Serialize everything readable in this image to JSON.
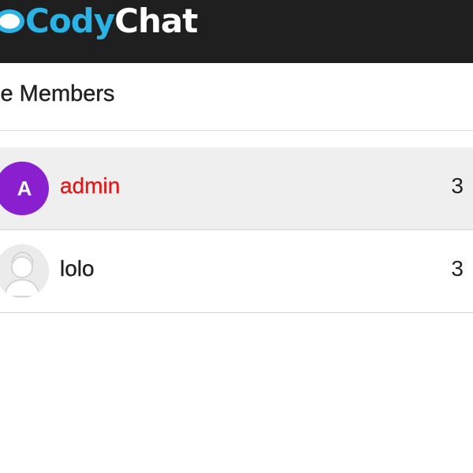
{
  "app": {
    "logo_part1": "Cody",
    "logo_part2": "Chat"
  },
  "panel": {
    "title": "ce Members"
  },
  "members": [
    {
      "name": "admin",
      "avatar_letter": "A",
      "count": "3",
      "name_color": "#e01b1b",
      "avatar_color": "#8a1fd0"
    },
    {
      "name": "lolo",
      "count": "3",
      "avatar": "default-avatar-icon"
    }
  ],
  "colors": {
    "header_bg": "#1f1f1f",
    "logo_accent": "#2bb3e6",
    "highlight_row": "#efefef"
  }
}
